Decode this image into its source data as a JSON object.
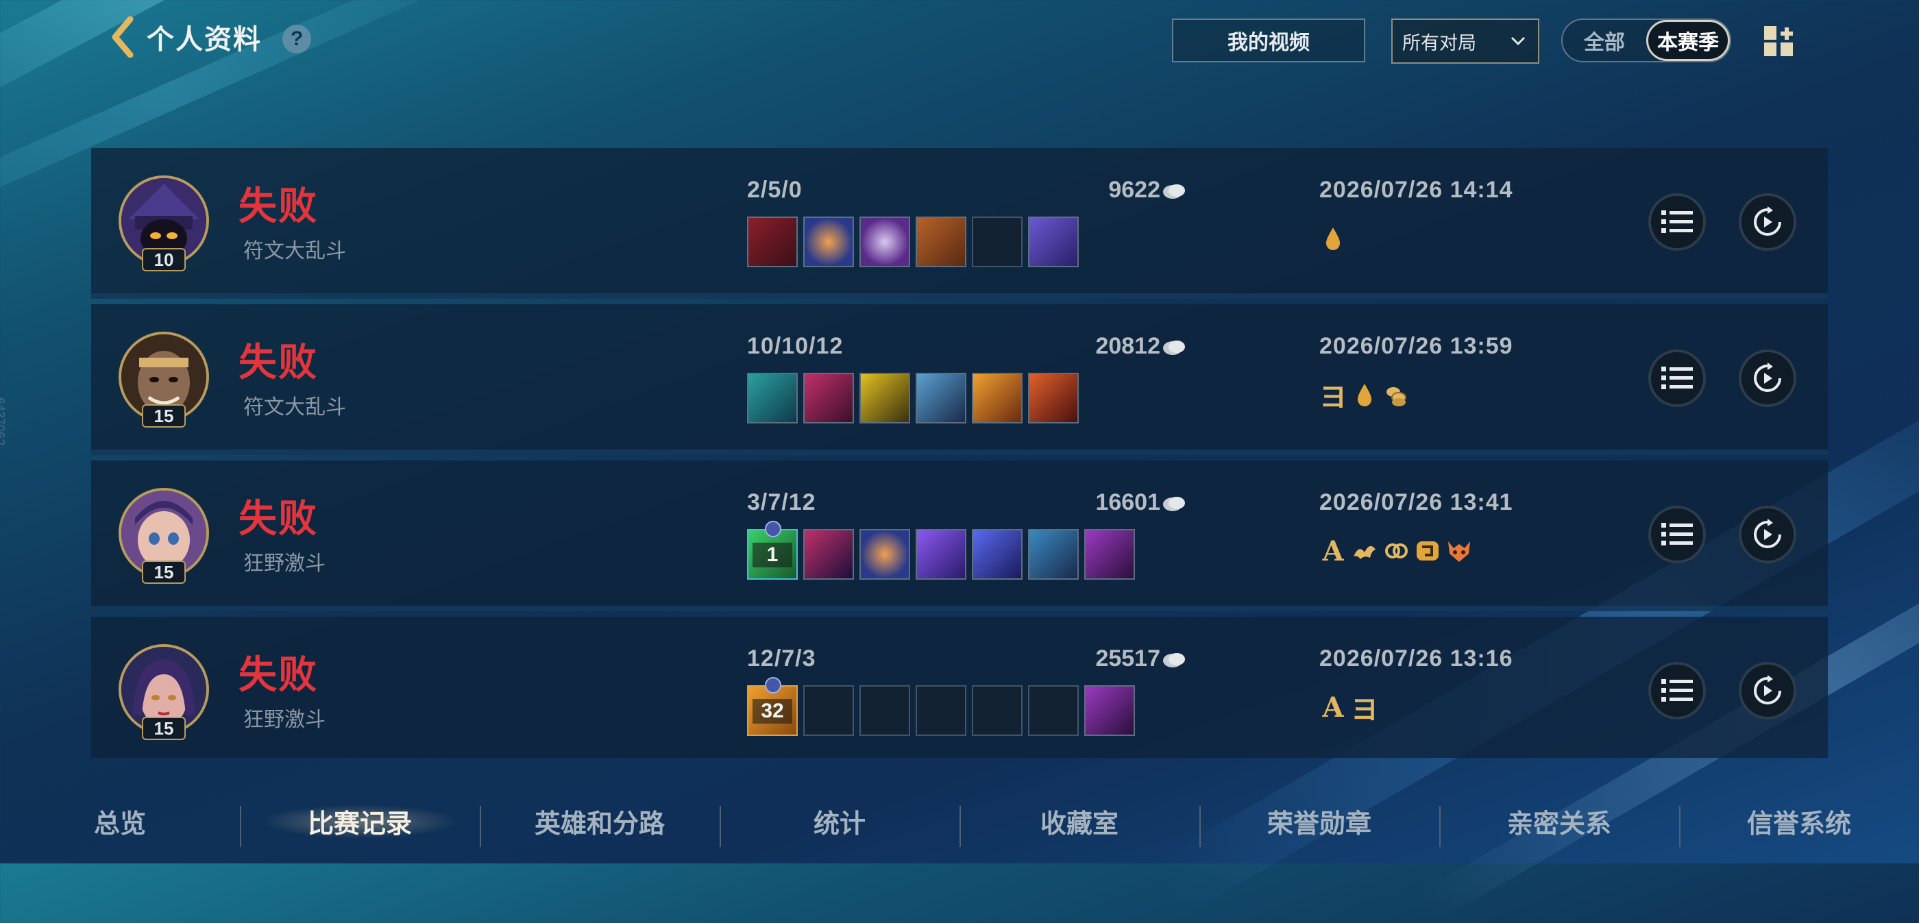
{
  "header": {
    "title": "个人资料",
    "help_glyph": "?",
    "video_button": "我的视频",
    "match_filter": "所有对局",
    "season_toggle": {
      "all": "全部",
      "season": "本赛季",
      "selected": "本赛季"
    }
  },
  "matches": [
    {
      "result": "失败",
      "mode": "符文大乱斗",
      "level": "10",
      "kda": "2/5/0",
      "gold": "9622",
      "datetime": "2026/07/26 14:14",
      "items": [
        "item",
        "item",
        "item",
        "item",
        "empty",
        "item"
      ],
      "badges": [
        {
          "type": "icon",
          "name": "drop-icon"
        }
      ]
    },
    {
      "result": "失败",
      "mode": "符文大乱斗",
      "level": "15",
      "kda": "10/10/12",
      "gold": "20812",
      "datetime": "2026/07/26 13:59",
      "items": [
        "item",
        "item",
        "item",
        "item",
        "item",
        "item"
      ],
      "badges": [
        {
          "type": "letter",
          "text": "ヨ"
        },
        {
          "type": "icon",
          "name": "drop-icon"
        },
        {
          "type": "icon",
          "name": "coins-icon"
        }
      ]
    },
    {
      "result": "失败",
      "mode": "狂野激斗",
      "level": "15",
      "kda": "3/7/12",
      "gold": "16601",
      "datetime": "2026/07/26 13:41",
      "items": [
        "item",
        "item",
        "item",
        "item",
        "item",
        "item",
        "item"
      ],
      "item_counts": {
        "0": "1"
      },
      "badges": [
        {
          "type": "letter",
          "text": "A"
        },
        {
          "type": "icon",
          "name": "dragon-icon"
        },
        {
          "type": "icon",
          "name": "link-icon"
        },
        {
          "type": "icon",
          "name": "hook-icon"
        },
        {
          "type": "icon",
          "name": "demon-icon"
        }
      ]
    },
    {
      "result": "失败",
      "mode": "狂野激斗",
      "level": "15",
      "kda": "12/7/3",
      "gold": "25517",
      "datetime": "2026/07/26 13:16",
      "items": [
        "item",
        "empty",
        "empty",
        "empty",
        "empty",
        "empty",
        "item"
      ],
      "item_counts": {
        "0": "32"
      },
      "badges": [
        {
          "type": "letter",
          "text": "A"
        },
        {
          "type": "letter",
          "text": "ヨ"
        }
      ]
    }
  ],
  "tabs": [
    {
      "label": "总览",
      "active": false
    },
    {
      "label": "比赛记录",
      "active": true
    },
    {
      "label": "英雄和分路",
      "active": false
    },
    {
      "label": "统计",
      "active": false
    },
    {
      "label": "收藏室",
      "active": false
    },
    {
      "label": "荣誉勋章",
      "active": false
    },
    {
      "label": "亲密关系",
      "active": false
    },
    {
      "label": "信誉系统",
      "active": false
    }
  ],
  "side_mark": "6437062",
  "colors": {
    "defeat": "#e3353b",
    "gold_accent": "#e2b760",
    "portrait_ring": "#b99c5d"
  }
}
